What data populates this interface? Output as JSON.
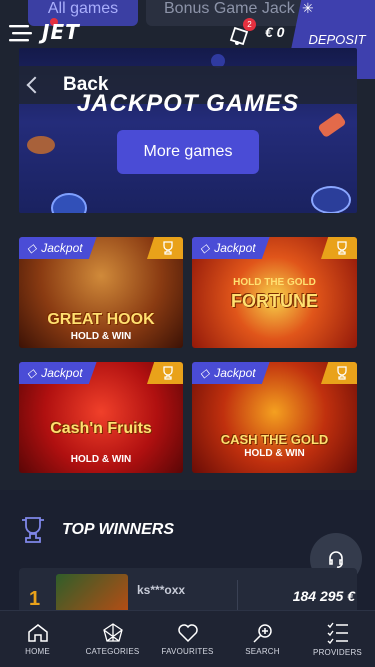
{
  "top_tabs": [
    "All games",
    "Bonus Game Jack"
  ],
  "header": {
    "logo": "JET",
    "notification_count": "2",
    "balance": "€ 0",
    "deposit_label": "DEPOSIT"
  },
  "banner": {
    "back_label": "Back",
    "title": "JACKPOT GAMES",
    "more_button": "More games"
  },
  "games": [
    {
      "tag": "Jackpot",
      "title": "GREAT HOOK",
      "subtitle": "HOLD & WIN"
    },
    {
      "tag": "Jackpot",
      "title": "FORTUNE",
      "subtitle": "HOLD THE GOLD"
    },
    {
      "tag": "Jackpot",
      "title": "Cash'n Fruits",
      "subtitle": "HOLD & WIN"
    },
    {
      "tag": "Jackpot",
      "title": "CASH THE GOLD",
      "subtitle": "HOLD & WIN"
    }
  ],
  "winners": {
    "title": "TOP WINNERS",
    "rows": [
      {
        "rank": "1",
        "name": "ks***oxx",
        "amount": "184 295 €"
      }
    ]
  },
  "bottom_nav": [
    {
      "label": "HOME",
      "icon": "home-icon"
    },
    {
      "label": "CATEGORIES",
      "icon": "categories-icon"
    },
    {
      "label": "FAVOURITES",
      "icon": "heart-icon"
    },
    {
      "label": "SEARCH",
      "icon": "search-icon"
    },
    {
      "label": "PROVIDERS",
      "icon": "providers-icon"
    }
  ],
  "colors": {
    "accent": "#4a4cd6",
    "background": "#1e2431",
    "trophy": "#e9a21a",
    "notification": "#e4303f"
  }
}
